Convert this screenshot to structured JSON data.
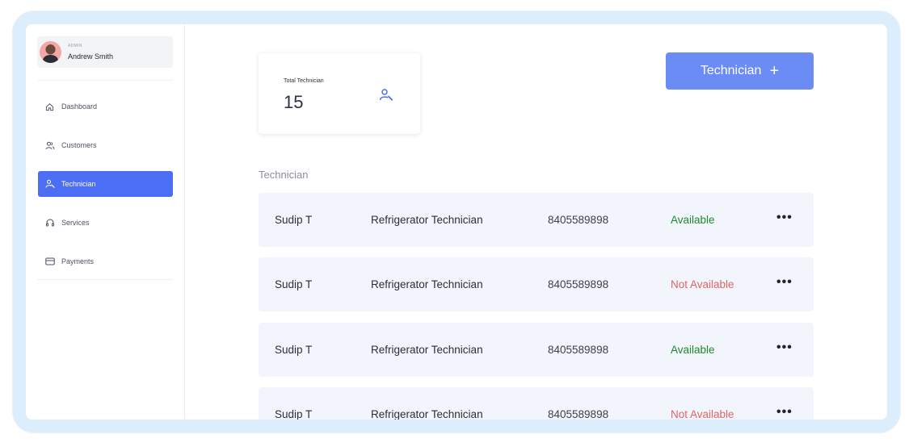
{
  "profile": {
    "role": "ADMIN",
    "name": "Andrew Smith"
  },
  "sidebar": {
    "items": [
      {
        "label": "Dashboard",
        "icon": "home-icon",
        "active": false
      },
      {
        "label": "Customers",
        "icon": "users-icon",
        "active": false
      },
      {
        "label": "Technician",
        "icon": "technician-icon",
        "active": true
      },
      {
        "label": "Services",
        "icon": "headset-icon",
        "active": false
      },
      {
        "label": "Payments",
        "icon": "card-icon",
        "active": false
      }
    ]
  },
  "stat": {
    "label": "Total Technician",
    "value": "15",
    "icon": "technician-icon"
  },
  "add_button": {
    "label": "Technician",
    "icon": "plus-icon"
  },
  "section_title": "Technician",
  "rows": [
    {
      "name": "Sudip T",
      "role": "Refrigerator Technician",
      "phone": "8405589898",
      "status": "Available",
      "more": "•••"
    },
    {
      "name": "Sudip T",
      "role": "Refrigerator Technician",
      "phone": "8405589898",
      "status": "Not Available",
      "more": "•••"
    },
    {
      "name": "Sudip T",
      "role": "Refrigerator Technician",
      "phone": "8405589898",
      "status": "Available",
      "more": "•••"
    },
    {
      "name": "Sudip T",
      "role": "Refrigerator Technician",
      "phone": "8405589898",
      "status": "Not Available",
      "more": "•••"
    }
  ],
  "colors": {
    "accent": "#4b6ef5",
    "button": "#6c8cf5",
    "available": "#1f8a2a",
    "not_available": "#e06565",
    "frame": "#dcedfb"
  }
}
